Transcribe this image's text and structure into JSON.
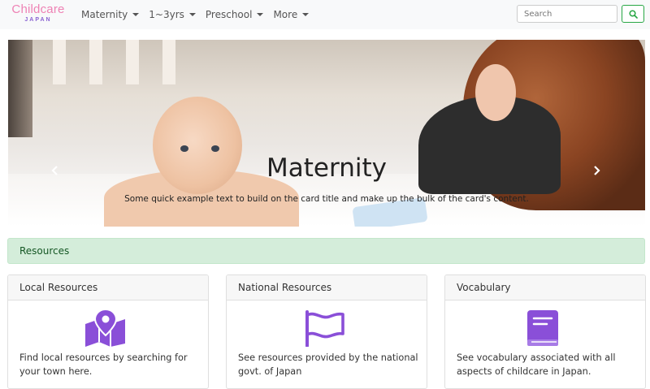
{
  "brand": {
    "name": "Childcare",
    "sub": "JAPAN"
  },
  "nav": {
    "items": [
      {
        "label": "Maternity"
      },
      {
        "label": "1~3yrs"
      },
      {
        "label": "Preschool"
      },
      {
        "label": "More"
      }
    ]
  },
  "search": {
    "placeholder": "Search",
    "button_icon": "search-icon"
  },
  "carousel": {
    "title": "Maternity",
    "text": "Some quick example text to build on the card title and make up the bulk of the card's content.",
    "prev_icon": "chevron-left-icon",
    "next_icon": "chevron-right-icon"
  },
  "alert": {
    "text": "Resources"
  },
  "cards": [
    {
      "title": "Local Resources",
      "icon": "map-pin-icon",
      "text": "Find local resources by searching for your town here."
    },
    {
      "title": "National Resources",
      "icon": "flag-icon",
      "text": "See resources provided by the national govt. of Japan"
    },
    {
      "title": "Vocabulary",
      "icon": "book-icon",
      "text": "See vocabulary associated with all aspects of childcare in Japan."
    }
  ],
  "colors": {
    "accent": "#8a4fd8",
    "alert_bg": "#d4edda",
    "search_btn": "#28a745",
    "brand_pink": "#ee82b4"
  }
}
